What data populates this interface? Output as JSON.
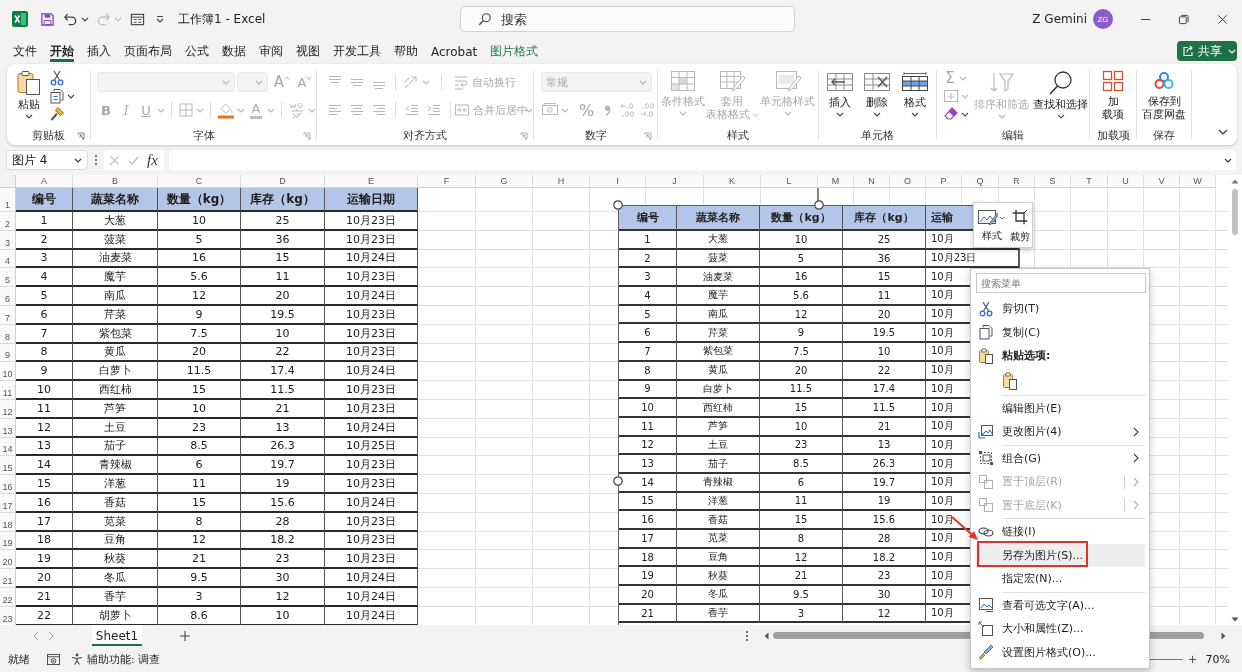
{
  "title_bar": {
    "quick_access": [
      {
        "kind": "save",
        "disabled": false
      },
      {
        "kind": "undo",
        "disabled": false
      },
      {
        "kind": "redo",
        "disabled": true
      },
      {
        "kind": "form",
        "disabled": false
      },
      {
        "kind": "customize",
        "disabled": false
      }
    ],
    "title": "工作簿1 - Excel",
    "search": {
      "placeholder": "搜索"
    },
    "user": {
      "name": "Z Gemini",
      "initials": "ZG"
    }
  },
  "menu_tabs": [
    {
      "label": "文件",
      "selected": false,
      "contextual": false
    },
    {
      "label": "开始",
      "selected": true,
      "contextual": false
    },
    {
      "label": "插入",
      "selected": false,
      "contextual": false
    },
    {
      "label": "页面布局",
      "selected": false,
      "contextual": false
    },
    {
      "label": "公式",
      "selected": false,
      "contextual": false
    },
    {
      "label": "数据",
      "selected": false,
      "contextual": false
    },
    {
      "label": "审阅",
      "selected": false,
      "contextual": false
    },
    {
      "label": "视图",
      "selected": false,
      "contextual": false
    },
    {
      "label": "开发工具",
      "selected": false,
      "contextual": false
    },
    {
      "label": "帮助",
      "selected": false,
      "contextual": false
    },
    {
      "label": "Acrobat",
      "selected": false,
      "contextual": false
    },
    {
      "label": "图片格式",
      "selected": false,
      "contextual": true
    }
  ],
  "share_button": {
    "label": "共享"
  },
  "ribbon": {
    "clipboard": {
      "paste": "粘贴",
      "label": "剪贴板"
    },
    "font": {
      "disabled": true,
      "grow": "A",
      "shrink": "A",
      "bold": "B",
      "italic": "I",
      "underline": "U",
      "font_color": "A",
      "label": "字体"
    },
    "alignment": {
      "disabled": true,
      "wrap_text": "自动换行",
      "merge": "合并后居中",
      "label": "对齐方式"
    },
    "number": {
      "disabled": true,
      "format": "常规",
      "percent": "%",
      "label": "数字"
    },
    "styles": {
      "buttons": [
        {
          "kind": "conditional",
          "lines": [
            "条件格式"
          ],
          "disabled": true
        },
        {
          "kind": "table",
          "lines": [
            "套用",
            "表格格式"
          ],
          "disabled": true
        },
        {
          "kind": "cellstyle",
          "lines": [
            "单元格样式"
          ],
          "disabled": true
        }
      ],
      "label": "样式"
    },
    "cells": {
      "buttons": [
        {
          "kind": "insert",
          "label": "插入"
        },
        {
          "kind": "delete",
          "label": "删除"
        },
        {
          "kind": "format",
          "label": "格式"
        }
      ],
      "label": "单元格"
    },
    "editing": {
      "small_buttons": [
        {
          "kind": "autosum",
          "label": "Σ",
          "disabled": true
        },
        {
          "kind": "fill",
          "disabled": true
        },
        {
          "kind": "clear",
          "disabled": false
        }
      ],
      "buttons": [
        {
          "kind": "sort",
          "label": "排序和筛选",
          "disabled": true
        },
        {
          "kind": "find",
          "label": "查找和选择",
          "disabled": false
        }
      ],
      "label": "编辑"
    },
    "addins": {
      "lines": [
        "加",
        "载项"
      ],
      "label": "加载项"
    },
    "save": {
      "lines": [
        "保存到",
        "百度网盘"
      ],
      "label": "保存"
    }
  },
  "formula_bar": {
    "name_box": "图片 4",
    "function_label": "fx"
  },
  "sheet": {
    "column_letters": [
      "A",
      "B",
      "C",
      "D",
      "E",
      "F",
      "G",
      "H",
      "I",
      "J",
      "K",
      "L",
      "M",
      "N",
      "O",
      "P",
      "Q",
      "R",
      "S",
      "T",
      "U",
      "V",
      "W"
    ],
    "row_numbers": [
      "1",
      "2",
      "3",
      "4",
      "5",
      "6",
      "7",
      "8",
      "9",
      "10",
      "11",
      "12",
      "13",
      "14",
      "15",
      "16",
      "17",
      "18",
      "19",
      "20",
      "21",
      "22",
      "23"
    ],
    "table": {
      "columns": [
        "编号",
        "蔬菜名称",
        "数量（kg）",
        "库存（kg）",
        "运输日期"
      ],
      "rows": [
        [
          "1",
          "大葱",
          "10",
          "25",
          "10月23日"
        ],
        [
          "2",
          "菠菜",
          "5",
          "36",
          "10月23日"
        ],
        [
          "3",
          "油麦菜",
          "16",
          "15",
          "10月24日"
        ],
        [
          "4",
          "魔芋",
          "5.6",
          "11",
          "10月23日"
        ],
        [
          "5",
          "南瓜",
          "12",
          "20",
          "10月24日"
        ],
        [
          "6",
          "芹菜",
          "9",
          "19.5",
          "10月23日"
        ],
        [
          "7",
          "紫包菜",
          "7.5",
          "10",
          "10月23日"
        ],
        [
          "8",
          "黄瓜",
          "20",
          "22",
          "10月23日"
        ],
        [
          "9",
          "白萝卜",
          "11.5",
          "17.4",
          "10月24日"
        ],
        [
          "10",
          "西红柿",
          "15",
          "11.5",
          "10月23日"
        ],
        [
          "11",
          "芦笋",
          "10",
          "21",
          "10月23日"
        ],
        [
          "12",
          "土豆",
          "23",
          "13",
          "10月24日"
        ],
        [
          "13",
          "茄子",
          "8.5",
          "26.3",
          "10月25日"
        ],
        [
          "14",
          "青辣椒",
          "6",
          "19.7",
          "10月23日"
        ],
        [
          "15",
          "洋葱",
          "11",
          "19",
          "10月23日"
        ],
        [
          "16",
          "香菇",
          "15",
          "15.6",
          "10月24日"
        ],
        [
          "17",
          "苋菜",
          "8",
          "28",
          "10月23日"
        ],
        [
          "18",
          "豆角",
          "12",
          "18.2",
          "10月23日"
        ],
        [
          "19",
          "秋葵",
          "21",
          "23",
          "10月23日"
        ],
        [
          "20",
          "冬瓜",
          "9.5",
          "30",
          "10月24日"
        ],
        [
          "21",
          "香芋",
          "3",
          "12",
          "10月24日"
        ],
        [
          "22",
          "胡萝卜",
          "8.6",
          "10",
          "10月24日"
        ]
      ]
    },
    "picture": {
      "selected": true,
      "columns": [
        "编号",
        "蔬菜名称",
        "数量（kg）",
        "库存（kg）",
        "运输"
      ],
      "rows": [
        [
          "1",
          "大葱",
          "10",
          "25",
          "10月"
        ],
        [
          "2",
          "菠菜",
          "5",
          "36",
          "10月23日"
        ],
        [
          "3",
          "油麦菜",
          "16",
          "15",
          "10月"
        ],
        [
          "4",
          "魔芋",
          "5.6",
          "11",
          "10月"
        ],
        [
          "5",
          "南瓜",
          "12",
          "20",
          "10月"
        ],
        [
          "6",
          "芹菜",
          "9",
          "19.5",
          "10月"
        ],
        [
          "7",
          "紫包菜",
          "7.5",
          "10",
          "10月"
        ],
        [
          "8",
          "黄瓜",
          "20",
          "22",
          "10月"
        ],
        [
          "9",
          "白萝卜",
          "11.5",
          "17.4",
          "10月"
        ],
        [
          "10",
          "西红柿",
          "15",
          "11.5",
          "10月"
        ],
        [
          "11",
          "芦笋",
          "10",
          "21",
          "10月"
        ],
        [
          "12",
          "土豆",
          "23",
          "13",
          "10月"
        ],
        [
          "13",
          "茄子",
          "8.5",
          "26.3",
          "10月"
        ],
        [
          "14",
          "青辣椒",
          "6",
          "19.7",
          "10月"
        ],
        [
          "15",
          "洋葱",
          "11",
          "19",
          "10月"
        ],
        [
          "16",
          "香菇",
          "15",
          "15.6",
          "10月"
        ],
        [
          "17",
          "苋菜",
          "8",
          "28",
          "10月"
        ],
        [
          "18",
          "豆角",
          "12",
          "18.2",
          "10月"
        ],
        [
          "19",
          "秋葵",
          "21",
          "23",
          "10月"
        ],
        [
          "20",
          "冬瓜",
          "9.5",
          "30",
          "10月"
        ],
        [
          "21",
          "香芋",
          "3",
          "12",
          "10月"
        ]
      ]
    }
  },
  "mini_toolbar": {
    "buttons": [
      {
        "kind": "style",
        "label": "样式"
      },
      {
        "kind": "crop",
        "label": "裁剪"
      }
    ]
  },
  "context_menu": {
    "search": {
      "placeholder": "搜索菜单"
    },
    "sections": [
      [
        {
          "kind": "cut",
          "label": "剪切(T)",
          "disabled": false,
          "highlighted": false,
          "submenu": false,
          "split": false
        },
        {
          "kind": "copy",
          "label": "复制(C)",
          "disabled": false,
          "highlighted": false,
          "submenu": false,
          "split": false
        },
        {
          "kind": "heading",
          "label": "粘贴选项:",
          "disabled": false,
          "highlighted": false,
          "submenu": false,
          "split": false
        },
        {
          "kind": "pasteoption",
          "disabled": false,
          "highlighted": false,
          "submenu": false,
          "split": false
        }
      ],
      [
        {
          "kind": "edit",
          "label": "编辑图片(E)",
          "disabled": false,
          "highlighted": false,
          "submenu": false,
          "split": false
        },
        {
          "kind": "change",
          "label": "更改图片(4)",
          "disabled": false,
          "highlighted": false,
          "submenu": true,
          "split": false
        }
      ],
      [
        {
          "kind": "group",
          "label": "组合(G)",
          "disabled": false,
          "highlighted": false,
          "submenu": true,
          "split": false
        },
        {
          "kind": "front",
          "label": "置于顶层(R)",
          "disabled": true,
          "highlighted": false,
          "submenu": true,
          "split": true
        },
        {
          "kind": "back",
          "label": "置于底层(K)",
          "disabled": true,
          "highlighted": false,
          "submenu": true,
          "split": true
        }
      ],
      [
        {
          "kind": "link",
          "label": "链接(I)",
          "disabled": false,
          "highlighted": false,
          "submenu": false,
          "split": false
        },
        {
          "kind": "saveas",
          "label": "另存为图片(S)...",
          "disabled": false,
          "highlighted": true,
          "submenu": false,
          "split": false
        },
        {
          "kind": "macro",
          "label": "指定宏(N)...",
          "disabled": false,
          "highlighted": false,
          "submenu": false,
          "split": false
        }
      ],
      [
        {
          "kind": "alttext",
          "label": "查看可选文字(A)...",
          "disabled": false,
          "highlighted": false,
          "submenu": false,
          "split": false
        },
        {
          "kind": "size",
          "label": "大小和属性(Z)...",
          "disabled": false,
          "highlighted": false,
          "submenu": false,
          "split": false
        },
        {
          "kind": "format",
          "label": "设置图片格式(O)...",
          "disabled": false,
          "highlighted": false,
          "submenu": false,
          "split": false
        }
      ]
    ]
  },
  "annotations": {
    "pointer_arrow": true,
    "highlight_frame": true
  },
  "sheet_tabs": {
    "tabs": [
      {
        "label": "Sheet1",
        "selected": true
      }
    ]
  },
  "status_bar": {
    "ready": "就绪",
    "accessibility": "辅助功能: 调查",
    "zoom": "70%"
  }
}
